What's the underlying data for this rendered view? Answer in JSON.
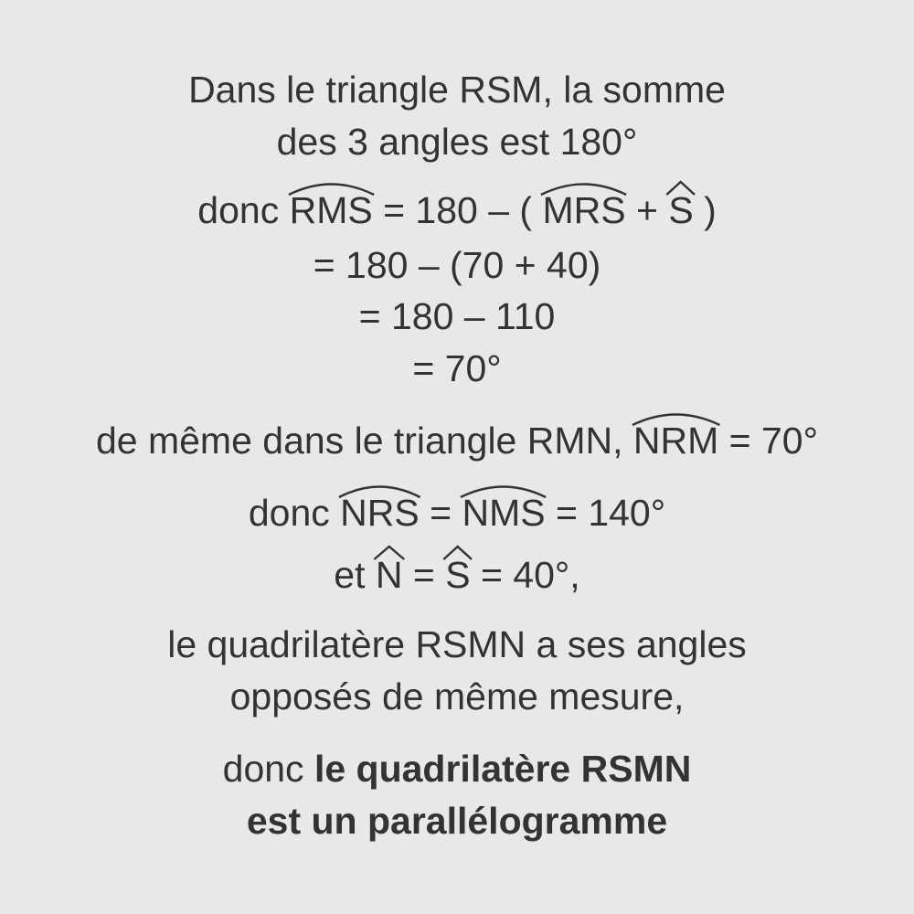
{
  "lines": {
    "l1": "Dans le triangle RSM, la somme",
    "l2": "des 3 angles est 180°",
    "l3": {
      "prefix": "donc ",
      "angle1": "RMS",
      "mid": " = 180 – ( ",
      "angle2": "MRS",
      "plus": " + ",
      "angle3": "S",
      "suffix": " )"
    },
    "l4": "= 180 – (70 + 40)",
    "l5": "= 180 – 110",
    "l6": "= 70°",
    "l7": {
      "prefix": "de même dans le triangle RMN, ",
      "angle1": "NRM",
      "suffix": " = 70°"
    },
    "l8": {
      "prefix": "donc ",
      "angle1": "NRS",
      "mid": " = ",
      "angle2": "NMS",
      "suffix": " = 140°"
    },
    "l9": {
      "prefix": "et ",
      "angle1": "N",
      "mid": " = ",
      "angle2": "S",
      "suffix": " =  40°,"
    },
    "l10": "le quadrilatère RSMN a ses angles",
    "l11": "opposés de même mesure,",
    "l12": {
      "prefix": "donc ",
      "bold": "le quadrilatère RSMN"
    },
    "l13": "est un parallélogramme"
  }
}
